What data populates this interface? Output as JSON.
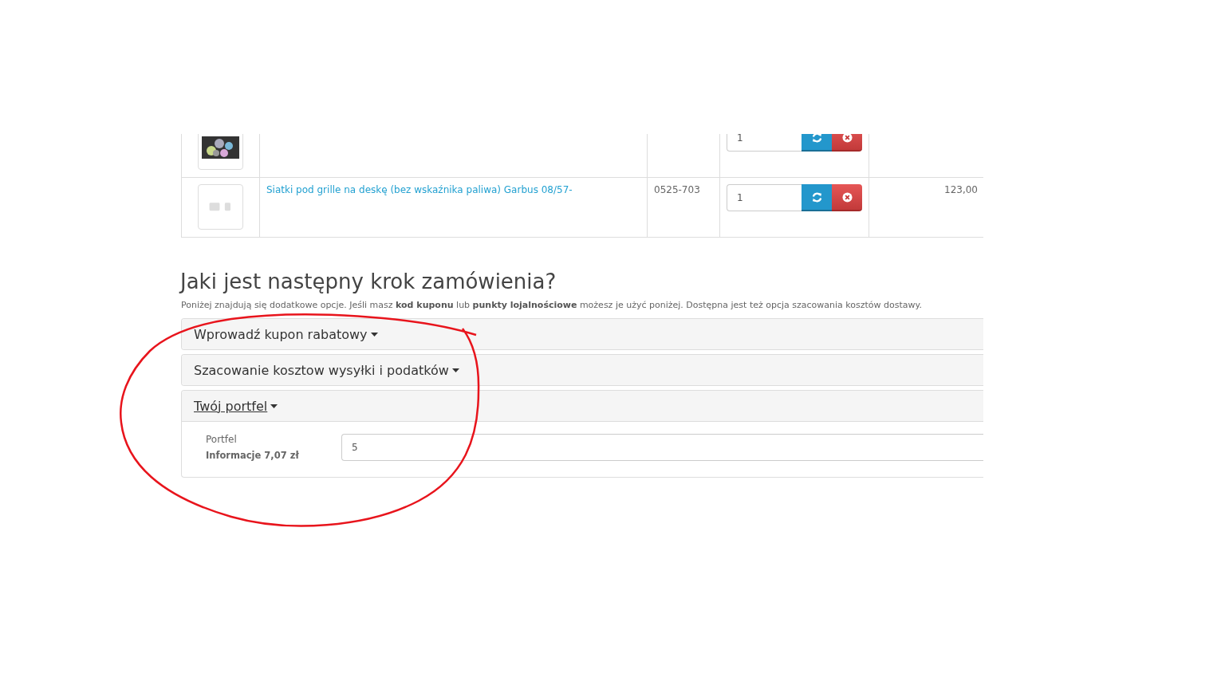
{
  "cart": {
    "rows": [
      {
        "quantity": "1"
      },
      {
        "name": "Siatki pod grille na deskę (bez wskaźnika paliwa) Garbus 08/57-",
        "model": "0525-703",
        "quantity": "1",
        "price": "123,00"
      }
    ]
  },
  "next_step": {
    "title": "Jaki jest następny krok zamówienia?",
    "intro": "Poniżej znajdują się dodatkowe opcje. Jeśli masz **kod kuponu** lub **punkty lojalnościowe** możesz je użyć poniżej. Dostępna jest też opcja szacowania kosztów dostawy."
  },
  "panels": [
    {
      "title": "Wprowadź kupon rabatowy",
      "expanded": false
    },
    {
      "title": "Szacowanie kosztow wysyłki i podatków",
      "expanded": false
    },
    {
      "title": "Twój portfel",
      "expanded": true,
      "label": "Portfel",
      "info": "Informacje 7,07 zł",
      "value": "5"
    }
  ],
  "annotation": {
    "kind": "circle"
  }
}
